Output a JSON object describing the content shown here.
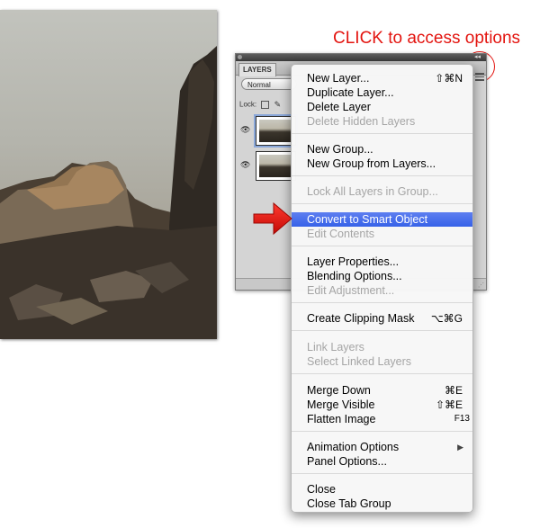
{
  "caption": "CLICK to access options",
  "layers_panel": {
    "tab_label": "LAYERS",
    "blend_mode": "Normal",
    "lock_label": "Lock:",
    "collapse_glyph": "◂◂"
  },
  "menu": {
    "items": [
      {
        "label": "New Layer...",
        "shortcut": "⇧⌘N",
        "disabled": false
      },
      {
        "label": "Duplicate Layer...",
        "shortcut": "",
        "disabled": false
      },
      {
        "label": "Delete Layer",
        "shortcut": "",
        "disabled": false
      },
      {
        "label": "Delete Hidden Layers",
        "shortcut": "",
        "disabled": true
      },
      {
        "label": "New Group...",
        "shortcut": "",
        "disabled": false
      },
      {
        "label": "New Group from Layers...",
        "shortcut": "",
        "disabled": false
      },
      {
        "label": "Lock All Layers in Group...",
        "shortcut": "",
        "disabled": true
      },
      {
        "label": "Convert to Smart Object",
        "shortcut": "",
        "disabled": false,
        "highlighted": true
      },
      {
        "label": "Edit Contents",
        "shortcut": "",
        "disabled": true
      },
      {
        "label": "Layer Properties...",
        "shortcut": "",
        "disabled": false
      },
      {
        "label": "Blending Options...",
        "shortcut": "",
        "disabled": false
      },
      {
        "label": "Edit Adjustment...",
        "shortcut": "",
        "disabled": true
      },
      {
        "label": "Create Clipping Mask",
        "shortcut": "⌥⌘G",
        "disabled": false
      },
      {
        "label": "Link Layers",
        "shortcut": "",
        "disabled": true
      },
      {
        "label": "Select Linked Layers",
        "shortcut": "",
        "disabled": true
      },
      {
        "label": "Merge Down",
        "shortcut": "⌘E",
        "disabled": false
      },
      {
        "label": "Merge Visible",
        "shortcut": "⇧⌘E",
        "disabled": false
      },
      {
        "label": "Flatten Image",
        "shortcut": "F13",
        "disabled": false
      },
      {
        "label": "Animation Options",
        "shortcut": "",
        "disabled": false,
        "submenu": true
      },
      {
        "label": "Panel Options...",
        "shortcut": "",
        "disabled": false
      },
      {
        "label": "Close",
        "shortcut": "",
        "disabled": false
      },
      {
        "label": "Close Tab Group",
        "shortcut": "",
        "disabled": false
      }
    ],
    "submenu_glyph": "▶"
  },
  "icons": {
    "eye": "eye-icon",
    "lock_transparent": "lock-transparency-icon",
    "brush": "brush-icon",
    "panel_menu": "panel-menu-icon",
    "arrow": "red-arrow-icon"
  },
  "colors": {
    "annotation": "#e3140f",
    "highlight": "#3661e8"
  }
}
